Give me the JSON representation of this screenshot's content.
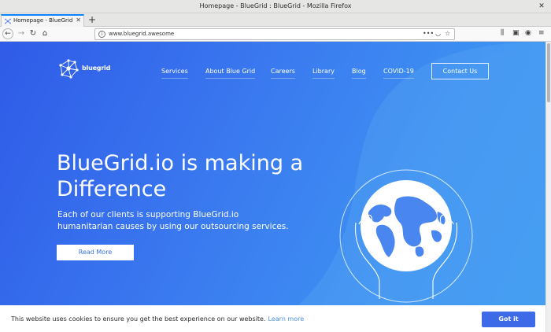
{
  "window": {
    "title": "Homepage - BlueGrid : BlueGrid - Mozilla Firefox",
    "close_glyph": "✕"
  },
  "tabs": [
    {
      "label": "Homepage - BlueGrid : Bl",
      "close_glyph": "✕"
    }
  ],
  "new_tab_glyph": "+",
  "toolbar": {
    "back_glyph": "←",
    "forward_glyph": "→",
    "reload_glyph": "↻",
    "home_glyph": "⌂",
    "url": "www.bluegrid.awesome",
    "page_actions_glyph": "•••",
    "pocket_glyph": "◡",
    "bookmark_glyph": "☆",
    "library_glyph": "⫼",
    "sidebar_glyph": "▣",
    "account_glyph": "◉",
    "menu_glyph": "≡"
  },
  "site": {
    "logo_text": "bluegrid",
    "nav": [
      "Services",
      "About Blue Grid",
      "Careers",
      "Library",
      "Blog",
      "COVID-19"
    ],
    "contact_label": "Contact Us",
    "hero_title": "BlueGrid.io is making a Difference",
    "hero_subtitle": "Each of our clients is supporting BlueGrid.io humanitarian causes by using our outsourcing services.",
    "read_more_label": "Read More"
  },
  "cookie": {
    "message": "This website uses cookies to ensure you get the best experience on our website.",
    "learn_more": "Learn more",
    "got_it": "Got it"
  },
  "colors": {
    "accent": "#0a84ff",
    "hero_start": "#2f5be8",
    "hero_end": "#3a9ef0",
    "button_blue": "#3d6be7"
  }
}
